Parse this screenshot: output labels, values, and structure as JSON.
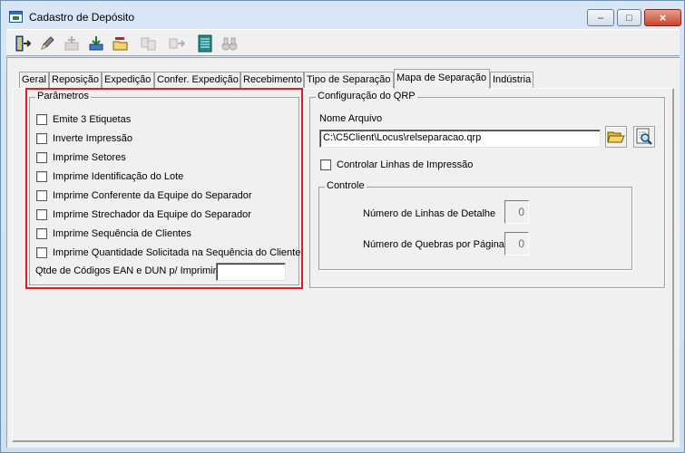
{
  "window": {
    "title": "Cadastro de Depósito",
    "controls": {
      "minimize": "–",
      "maximize": "□",
      "close": "×"
    }
  },
  "toolbar": {
    "buttons": [
      {
        "name": "exit",
        "icon": "exit-door-icon",
        "enabled": true
      },
      {
        "name": "edit",
        "icon": "pencil-edit-icon",
        "enabled": true
      },
      {
        "name": "new",
        "icon": "add-record-icon",
        "enabled": false
      },
      {
        "name": "save",
        "icon": "save-tray-icon",
        "enabled": true
      },
      {
        "name": "delete",
        "icon": "delete-folder-icon",
        "enabled": true
      },
      {
        "name": "copy",
        "icon": "copy-records-icon",
        "enabled": false
      },
      {
        "name": "transfer",
        "icon": "transfer-icon",
        "enabled": false
      },
      {
        "name": "list",
        "icon": "grid-list-icon",
        "enabled": true
      },
      {
        "name": "find",
        "icon": "binoculars-icon",
        "enabled": false
      }
    ]
  },
  "tabs": [
    {
      "label": "Geral",
      "active": false
    },
    {
      "label": "Reposição",
      "active": false
    },
    {
      "label": "Expedição",
      "active": false
    },
    {
      "label": "Confer. Expedição",
      "active": false
    },
    {
      "label": "Recebimento",
      "active": false
    },
    {
      "label": "Tipo de Separação",
      "active": false
    },
    {
      "label": "Mapa de Separação",
      "active": true
    },
    {
      "label": "Indústria",
      "active": false
    }
  ],
  "parametros": {
    "legend": "Parâmetros",
    "options": [
      {
        "label": "Emite 3 Etiquetas",
        "checked": false
      },
      {
        "label": "Inverte Impressão",
        "checked": false
      },
      {
        "label": "Imprime Setores",
        "checked": false
      },
      {
        "label": "Imprime Identificação do Lote",
        "checked": false
      },
      {
        "label": "Imprime Conferente da Equipe do Separador",
        "checked": false
      },
      {
        "label": "Imprime Strechador da Equipe do Separador",
        "checked": false
      },
      {
        "label": "Imprime Sequência de Clientes",
        "checked": false
      },
      {
        "label": "Imprime Quantidade Solicitada na Sequência do Cliente",
        "checked": false
      }
    ],
    "qtde_label": "Qtde de Códigos EAN e DUN p/ Imprimir",
    "qtde_value": ""
  },
  "qrp": {
    "legend": "Configuração do QRP",
    "file_label": "Nome Arquivo",
    "file_value": "C:\\C5Client\\Locus\\relseparacao.qrp",
    "browse_icon": "folder-open-icon",
    "preview_icon": "preview-magnifier-icon",
    "control_lines_label": "Controlar Linhas de Impressão",
    "control_lines_checked": false,
    "controle": {
      "legend": "Controle",
      "detail_lines_label": "Número de Linhas de Detalhe",
      "detail_lines_value": "0",
      "page_breaks_label": "Número de Quebras por Página",
      "page_breaks_value": "0"
    }
  },
  "colors": {
    "highlight": "#e01b1b",
    "panel": "#f0f0f0"
  }
}
